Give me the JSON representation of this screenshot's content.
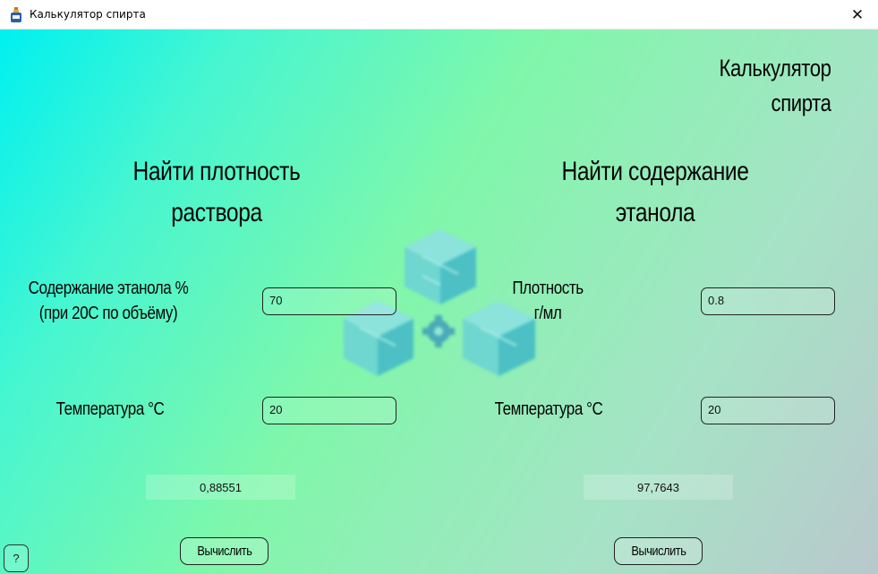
{
  "window": {
    "title": "Калькулятор спирта",
    "close_glyph": "✕"
  },
  "app": {
    "heading_line1": "Калькулятор",
    "heading_line2": "спирта"
  },
  "left": {
    "title_line1": "Найти плотность",
    "title_line2": "раствора",
    "label1_line1": "Содержание этанола %",
    "label1_line2": "(при 20С по объёму)",
    "input1_value": "70",
    "label2": "Температура °С",
    "input2_value": "20",
    "result": "0,88551",
    "button": "Вычислить"
  },
  "right": {
    "title_line1": "Найти содержание",
    "title_line2": "этанола",
    "label1_line1": "Плотность",
    "label1_line2": "г/мл",
    "input1_value": "0.8",
    "label2": "Температура °С",
    "input2_value": "20",
    "result": "97,7643",
    "button": "Вычислить"
  },
  "help": {
    "label": "?"
  },
  "icons": {
    "app_icon": "bottle-icon",
    "logo": "cubes-gear-logo"
  }
}
